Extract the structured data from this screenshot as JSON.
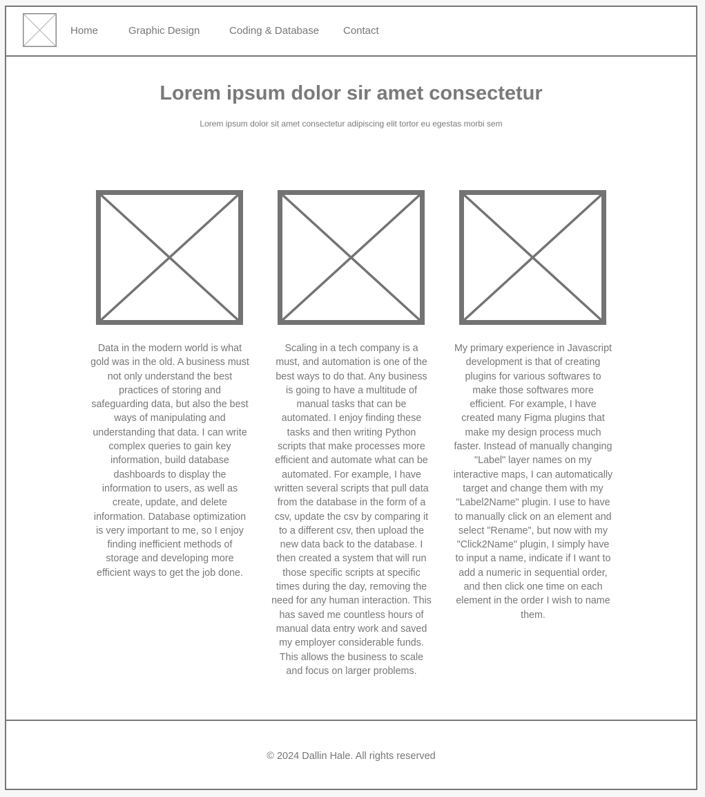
{
  "nav": {
    "items": [
      {
        "label": "Home"
      },
      {
        "label": "Graphic Design"
      },
      {
        "label": "Coding & Database"
      },
      {
        "label": "Contact"
      }
    ]
  },
  "hero": {
    "title": "Lorem ipsum dolor sir amet consectetur",
    "subtitle": "Lorem ipsum dolor sit amet consectetur adipiscing elit tortor eu egestas morbi sem"
  },
  "columns": [
    {
      "image_icon": "image-placeholder-icon",
      "text": "Data in the modern world is what gold was in the old. A business must not only understand the best practices of storing and safeguarding data, but also the best ways of manipulating and understanding that data. I can write complex queries to gain key information, build database dashboards to display the information to users, as well as create, update, and delete information. Database optimization is very important to me, so I enjoy finding inefficient methods of storage and developing more efficient ways to get the job done."
    },
    {
      "image_icon": "image-placeholder-icon",
      "text": "Scaling in a tech company is a must, and automation is one of the best ways to do that. Any business is going to have a multitude of manual tasks that can be automated. I enjoy finding these tasks and then writing Python scripts that make processes more efficient and automate what can be automated. For example, I have written several scripts that pull data from the database in the form of a csv, update the csv by comparing it to a different csv, then upload the new data back to the database. I then created a system that will run those specific scripts at specific times during the day, removing the need for any human interaction. This has saved me countless hours of manual data entry work and saved my employer considerable funds. This allows the business to scale and focus on larger problems."
    },
    {
      "image_icon": "image-placeholder-icon",
      "text": "My primary experience in Javascript development is that of creating plugins for various softwares to make those softwares more efficient. For example, I have created many Figma plugins that make my design process much faster. Instead of manually changing \"Label\" layer names on my interactive maps, I can automatically target and change them with my \"Label2Name\" plugin. I use to have to manually click on an element and select \"Rename\", but now with my \"Click2Name\" plugin, I simply have to input a name, indicate if I want to add a numeric in sequential order, and then click one time on each element in the order I wish to name them."
    }
  ],
  "footer": {
    "copyright": "© 2024 Dallin Hale. All rights reserved"
  },
  "colors": {
    "stroke": "#777777",
    "text": "#7a7a7a",
    "background": "#ffffff",
    "page_background": "#f7f7f7"
  }
}
